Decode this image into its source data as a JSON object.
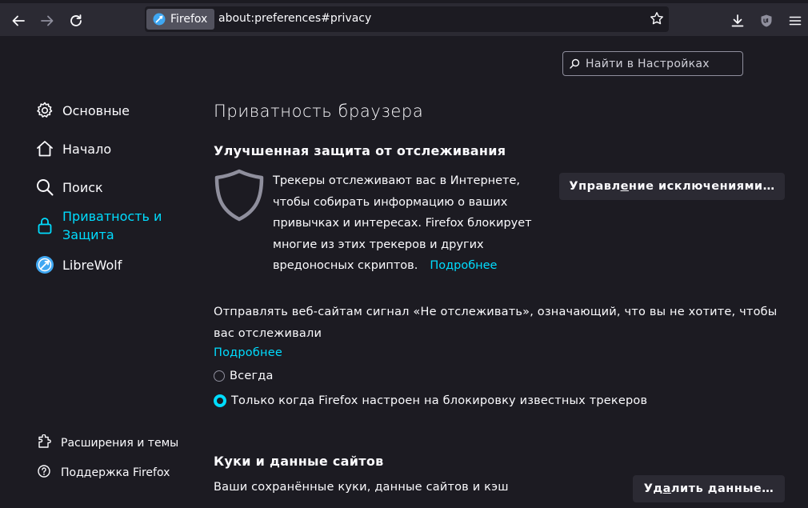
{
  "toolbar": {
    "identity_label": "Firefox",
    "url": "about:preferences#privacy",
    "icons": [
      "back-icon",
      "forward-icon",
      "reload-icon",
      "bookmark-star-icon",
      "download-icon",
      "ublock-origin-icon",
      "app-menu-icon"
    ]
  },
  "search": {
    "placeholder": "Найти в Настройках"
  },
  "sidebar": {
    "items": [
      {
        "label": "Основные",
        "icon": "gear-icon"
      },
      {
        "label": "Начало",
        "icon": "home-icon"
      },
      {
        "label": "Поиск",
        "icon": "search-icon"
      },
      {
        "label": "Приватность и Защита",
        "label_line1": "Приватность и",
        "label_line2": "Защита",
        "icon": "lock-icon",
        "selected": true
      },
      {
        "label": "LibreWolf",
        "icon": "librewolf-icon"
      }
    ],
    "footer": [
      {
        "label": "Расширения и темы",
        "icon": "puzzle-icon"
      },
      {
        "label": "Поддержка Firefox",
        "icon": "help-icon"
      }
    ]
  },
  "main": {
    "title": "Приватность браузера",
    "etp": {
      "heading": "Улучшенная защита от отслеживания",
      "line1": "Трекеры отслеживают вас в Интернете,",
      "line2": "чтобы собирать информацию о ваших",
      "line3": "привычках и интересах. Firefox блокирует",
      "line4": "многие из этих трекеров и других",
      "line5": "вредоносных скриптов.",
      "learn_more": "Подробнее",
      "button_pre": "Управл",
      "button_key": "е",
      "button_post": "ние исключениями…"
    },
    "dnt": {
      "text": "Отправлять веб-сайтам сигнал «Не отслеживать», означающий, что вы не хотите, чтобы вас отслеживали",
      "learn_more": "Подробнее",
      "options": [
        {
          "label": "Всегда",
          "checked": false
        },
        {
          "label": "Только когда Firefox настроен на блокировку известных трекеров",
          "checked": true
        }
      ]
    },
    "cookies": {
      "heading": "Куки и данные сайтов",
      "text": "Ваши сохранённые куки, данные сайтов и кэш",
      "button_pre": "Уд",
      "button_key": "а",
      "button_post": "лить данные…"
    }
  },
  "colors": {
    "accent": "#00ddff",
    "background": "#1c1b22",
    "toolbar": "#2b2a33",
    "text": "#fbfbfe"
  }
}
